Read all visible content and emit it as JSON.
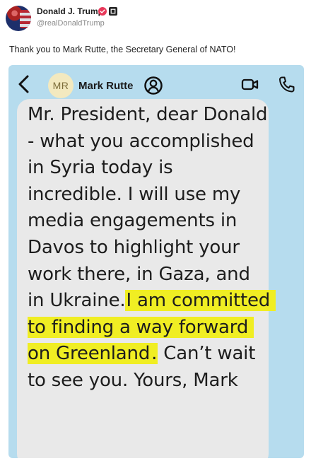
{
  "post": {
    "author_name": "Donald J. Trump",
    "author_handle": "@realDonaldTrump",
    "text": "Thank you to Mark Rutte, the Secretary General of NATO!"
  },
  "chat": {
    "contact_initials": "MR",
    "contact_name": "Mark Rutte",
    "message_parts": {
      "plain_1": "Mr. President, dear Donald - what you accomplished in Syria today is incredible. I will use my media engagements in Davos to highlight your work there, in Gaza, and in Ukraine.",
      "highlight_1": "I am committed to finding a way forward on Greenland",
      "highlight_period": ".",
      "plain_2": "Can’t wait to see you. Yours, Mark"
    }
  },
  "colors": {
    "chat_background": "#b6dcee",
    "bubble": "#e9e9e9",
    "highlight": "#f0ee23",
    "verified_badge": "#e8395a"
  },
  "icons": {
    "back": "chevron-left-icon",
    "contact_info": "person-circle-icon",
    "video": "video-camera-icon",
    "call": "phone-icon",
    "verified": "verified-badge-icon"
  }
}
